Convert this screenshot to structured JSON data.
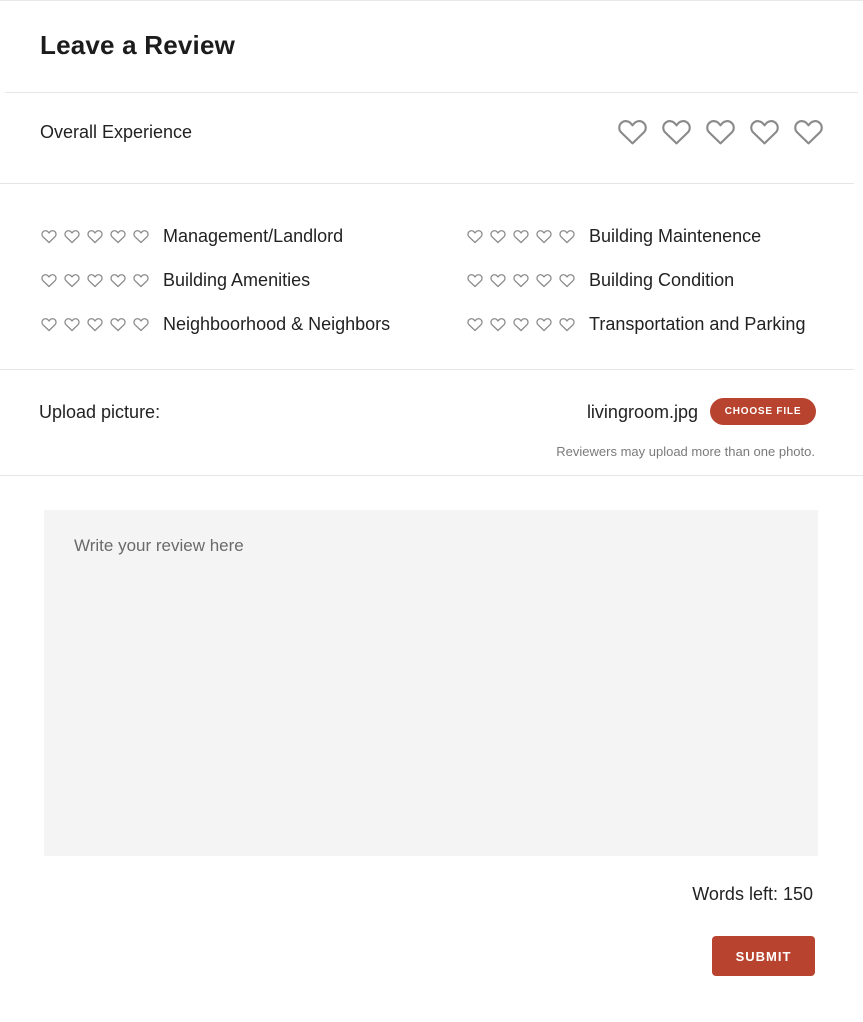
{
  "header": {
    "title": "Leave a Review"
  },
  "overall": {
    "label": "Overall Experience",
    "rating": 0,
    "max_rating": 5,
    "icon": "heart-outline-icon"
  },
  "categories": [
    {
      "label": "Management/Landlord",
      "rating": 0
    },
    {
      "label": "Building Maintenence",
      "rating": 0
    },
    {
      "label": "Building Amenities",
      "rating": 0
    },
    {
      "label": "Building Condition",
      "rating": 0
    },
    {
      "label": "Neighboorhood & Neighbors",
      "rating": 0
    },
    {
      "label": "Transportation and Parking",
      "rating": 0
    }
  ],
  "upload": {
    "label": "Upload picture:",
    "filename": "livingroom.jpg",
    "button_label": "CHOOSE FILE",
    "hint": "Reviewers may upload more than one photo."
  },
  "review": {
    "placeholder": "Write your review here",
    "words_left_label": "Words left: 150"
  },
  "submit": {
    "label": "SUBMIT"
  },
  "colors": {
    "accent": "#b8432f",
    "heart_stroke": "#8a8a8a",
    "textarea_bg": "#f4f4f4"
  }
}
